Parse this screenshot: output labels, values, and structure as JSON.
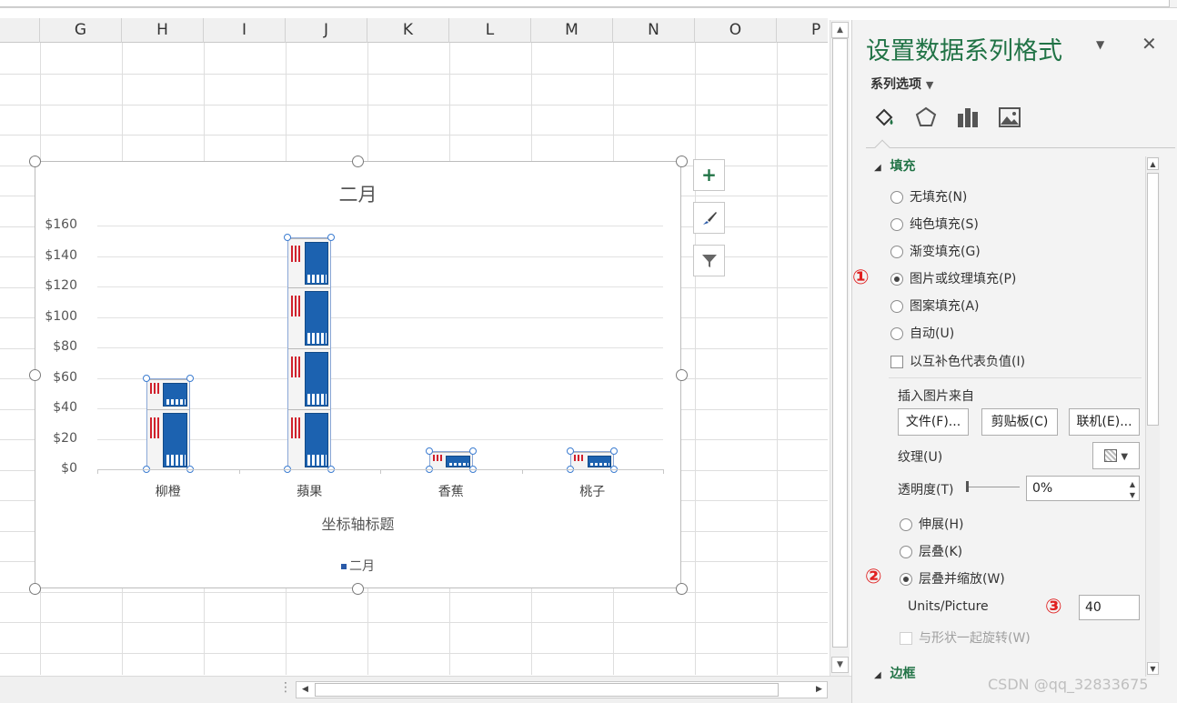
{
  "sheet": {
    "columns": [
      "G",
      "H",
      "I",
      "J",
      "K",
      "L",
      "M",
      "N",
      "O",
      "P"
    ]
  },
  "chart": {
    "side_buttons": {
      "add": "+",
      "style": "brush-icon",
      "filter": "filter-icon"
    }
  },
  "chart_data": {
    "type": "bar",
    "title": "二月",
    "categories": [
      "柳橙",
      "蘋果",
      "香蕉",
      "桃子"
    ],
    "series": [
      {
        "name": "二月",
        "values": [
          60,
          152,
          12,
          12
        ]
      }
    ],
    "xlabel": "坐标轴标题",
    "ylabel": "",
    "ylim": [
      0,
      160
    ],
    "yticks": [
      "$160",
      "$140",
      "$120",
      "$100",
      "$80",
      "$60",
      "$40",
      "$20",
      "$0"
    ],
    "legend_position": "bottom",
    "fill": "picture-stack",
    "grid": true
  },
  "pane": {
    "title": "设置数据系列格式",
    "series_options": "系列选项",
    "fill_section": "填充",
    "fill_options": [
      "无填充(N)",
      "纯色填充(S)",
      "渐变填充(G)",
      "图片或纹理填充(P)",
      "图案填充(A)",
      "自动(U)"
    ],
    "selected_fill": "图片或纹理填充(P)",
    "invert_label": "以互补色代表负值(I)",
    "insert_from": "插入图片来自",
    "btn_file": "文件(F)...",
    "btn_clipboard": "剪贴板(C)",
    "btn_online": "联机(E)...",
    "texture_label": "纹理(U)",
    "transparency_label": "透明度(T)",
    "transparency_value": "0%",
    "stretch_options": [
      "伸展(H)",
      "层叠(K)",
      "层叠并缩放(W)"
    ],
    "selected_stretch": "层叠并缩放(W)",
    "units_label": "Units/Picture",
    "units_value": "40",
    "rotate_label": "与形状一起旋转(W)",
    "border_section": "边框",
    "markers": [
      "①",
      "②",
      "③"
    ]
  },
  "watermark": "CSDN @qq_32833675"
}
